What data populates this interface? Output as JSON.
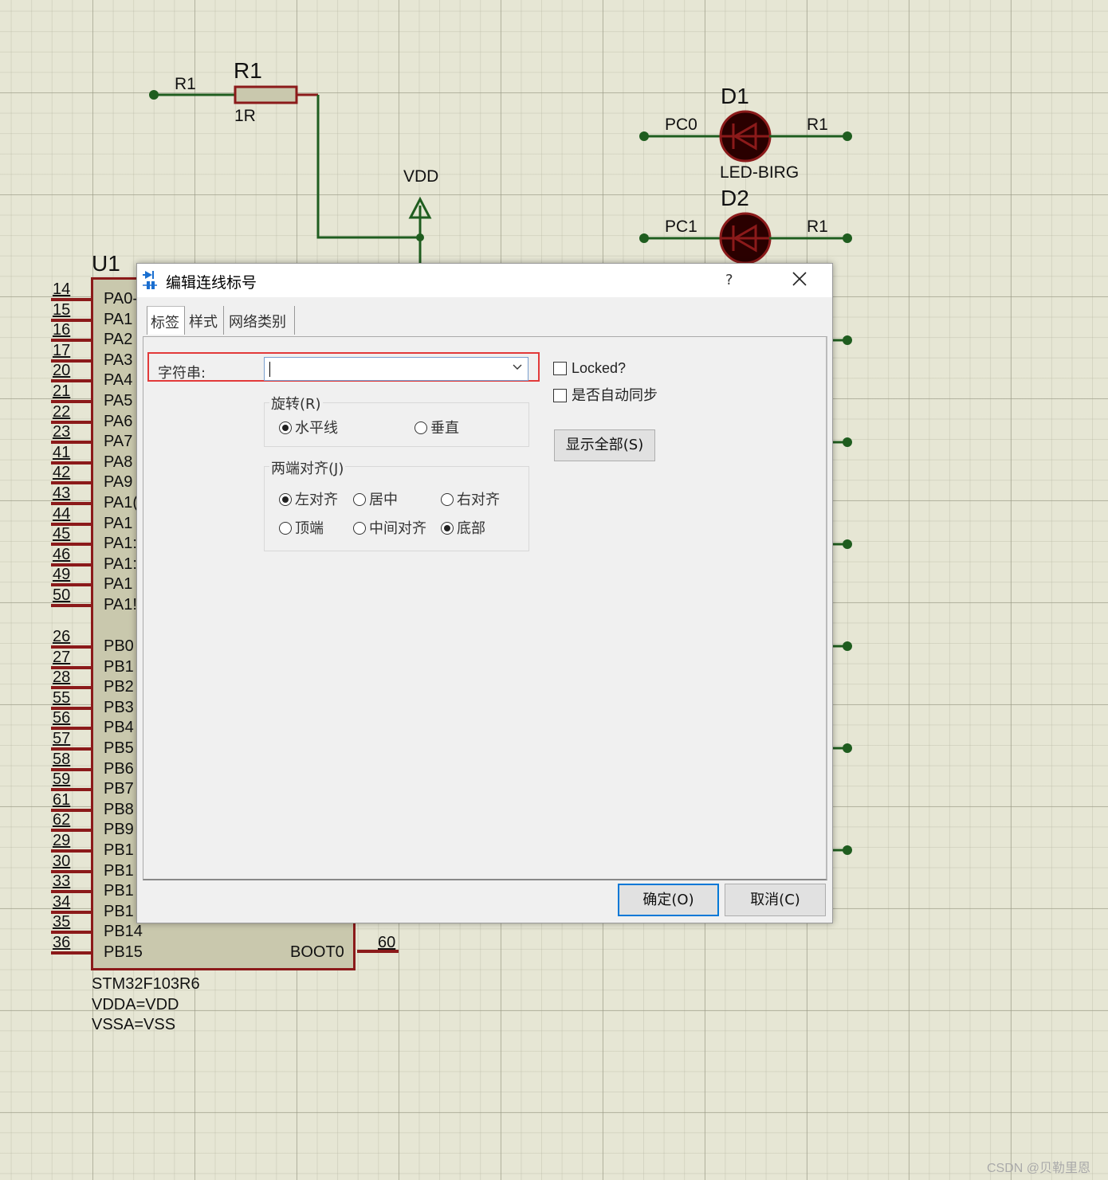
{
  "schematic": {
    "resistor": {
      "ref": "R1",
      "value": "1R",
      "net_label": "R1"
    },
    "power": {
      "label": "VDD"
    },
    "d1": {
      "ref": "D1",
      "left_net": "PC0",
      "right_net": "R1",
      "part": "LED-BIRG"
    },
    "d2": {
      "ref": "D2",
      "left_net": "PC1",
      "right_net": "R1"
    },
    "chip": {
      "ref": "U1",
      "part": "STM32F103R6",
      "attr1": "VDDA=VDD",
      "attr2": "VSSA=VSS",
      "boot_pin_name": "BOOT0",
      "boot_pin_number": "60",
      "pins_a": [
        {
          "num": "14",
          "name": "PA0-"
        },
        {
          "num": "15",
          "name": "PA1"
        },
        {
          "num": "16",
          "name": "PA2"
        },
        {
          "num": "17",
          "name": "PA3"
        },
        {
          "num": "20",
          "name": "PA4"
        },
        {
          "num": "21",
          "name": "PA5"
        },
        {
          "num": "22",
          "name": "PA6"
        },
        {
          "num": "23",
          "name": "PA7"
        },
        {
          "num": "41",
          "name": "PA8"
        },
        {
          "num": "42",
          "name": "PA9"
        },
        {
          "num": "43",
          "name": "PA1("
        },
        {
          "num": "44",
          "name": "PA1"
        },
        {
          "num": "45",
          "name": "PA1:"
        },
        {
          "num": "46",
          "name": "PA1:"
        },
        {
          "num": "49",
          "name": "PA1"
        },
        {
          "num": "50",
          "name": "PA1!"
        }
      ],
      "pins_b": [
        {
          "num": "26",
          "name": "PB0"
        },
        {
          "num": "27",
          "name": "PB1"
        },
        {
          "num": "28",
          "name": "PB2"
        },
        {
          "num": "55",
          "name": "PB3"
        },
        {
          "num": "56",
          "name": "PB4"
        },
        {
          "num": "57",
          "name": "PB5"
        },
        {
          "num": "58",
          "name": "PB6"
        },
        {
          "num": "59",
          "name": "PB7"
        },
        {
          "num": "61",
          "name": "PB8"
        },
        {
          "num": "62",
          "name": "PB9"
        },
        {
          "num": "29",
          "name": "PB1"
        },
        {
          "num": "30",
          "name": "PB1"
        },
        {
          "num": "33",
          "name": "PB1"
        },
        {
          "num": "34",
          "name": "PB1"
        },
        {
          "num": "35",
          "name": "PB14"
        },
        {
          "num": "36",
          "name": "PB15"
        }
      ]
    }
  },
  "dialog": {
    "title": "编辑连线标号",
    "help": "?",
    "tabs": [
      "标签",
      "样式",
      "网络类别"
    ],
    "string_label": "字符串:",
    "string_value": "",
    "locked_label": "Locked?",
    "autosync_label": "是否自动同步",
    "show_all_button": "显示全部(S)",
    "rotation": {
      "label": "旋转(R)",
      "options": [
        {
          "label": "水平线",
          "selected": true
        },
        {
          "label": "垂直",
          "selected": false
        }
      ]
    },
    "justify": {
      "label": "两端对齐(J)",
      "options": [
        {
          "label": "左对齐",
          "selected": true
        },
        {
          "label": "居中",
          "selected": false
        },
        {
          "label": "右对齐",
          "selected": false
        },
        {
          "label": "顶端",
          "selected": false
        },
        {
          "label": "中间对齐",
          "selected": false
        },
        {
          "label": "底部",
          "selected": true
        }
      ]
    },
    "ok_button": "确定(O)",
    "cancel_button": "取消(C)"
  },
  "colors": {
    "wire": "#1f5d1f",
    "component": "#8b1a1a",
    "chip_fill": "#c9c8ad",
    "accent": "#0078d7",
    "highlight": "#e23a3a"
  },
  "watermark": "CSDN @贝勒里恩"
}
